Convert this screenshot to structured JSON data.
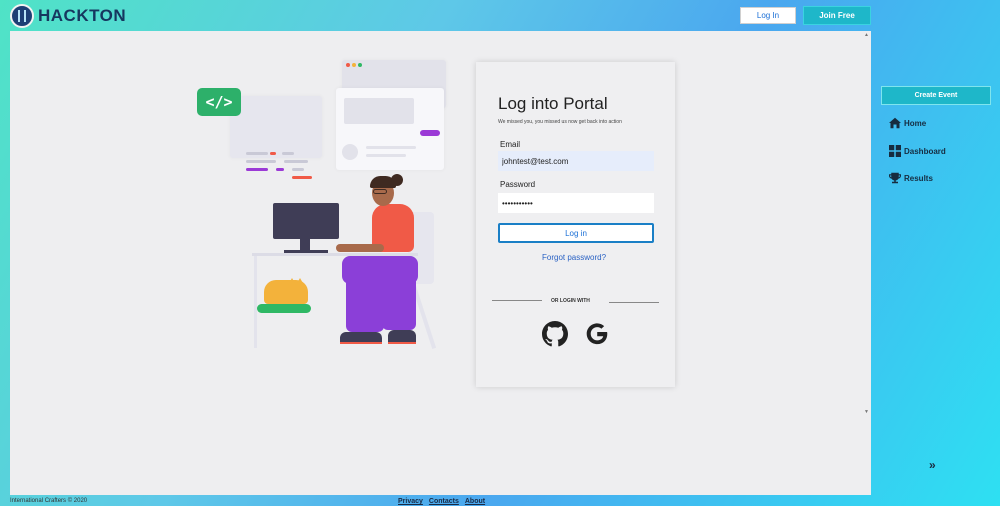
{
  "header": {
    "brand": "HACKTON",
    "login_label": "Log In",
    "join_label": "Join Free"
  },
  "login": {
    "title": "Log into Portal",
    "subtitle": "We missed you, you missed us now get back into action",
    "email_label": "Email",
    "email_value": "johntest@test.com",
    "password_label": "Password",
    "password_value": "•••••••••••",
    "submit_label": "Log in",
    "forgot_label": "Forgot password?",
    "or_label": "OR LOGIN WITH"
  },
  "sidebar": {
    "create_label": "Create Event",
    "items": [
      {
        "label": "Home",
        "icon": "home-icon"
      },
      {
        "label": "Dashboard",
        "icon": "dashboard-icon"
      },
      {
        "label": "Results",
        "icon": "trophy-icon"
      }
    ]
  },
  "illustration": {
    "code_symbol": "</>"
  },
  "footer": {
    "copyright": "International Crafters © 2020",
    "links": [
      "Privacy",
      "Contacts",
      "About"
    ]
  },
  "colors": {
    "accent": "#1eb7c9",
    "link": "#2a62c4",
    "brand_dark": "#16375f"
  }
}
